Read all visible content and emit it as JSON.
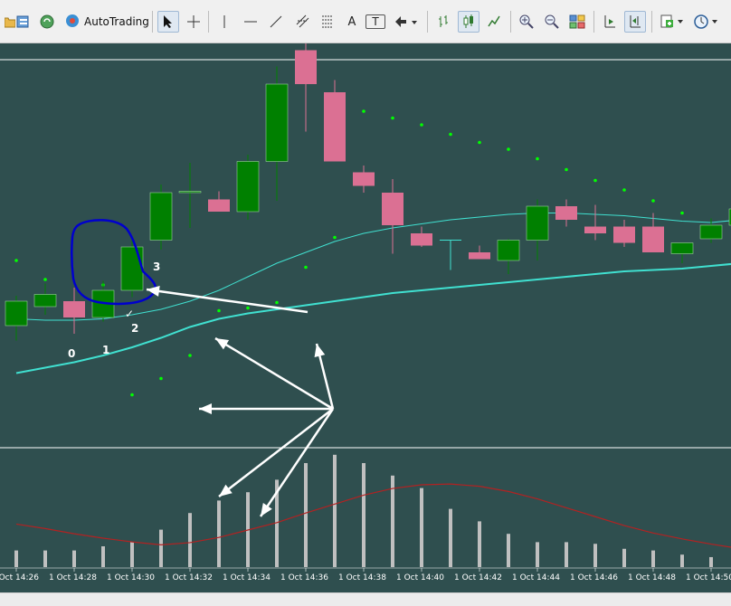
{
  "toolbar": {
    "autotrading_label": "AutoTrading",
    "font_button_label": "A",
    "text_label_button_label": "T",
    "icons": [
      "folder-icon",
      "market-watch-icon",
      "signals-icon",
      "autotrading-icon",
      "cursor-icon",
      "crosshair-icon",
      "vertical-line-icon",
      "horizontal-line-icon",
      "trendline-icon",
      "equidistant-channel-icon",
      "fibonacci-icon",
      "text-icon",
      "text-label-icon",
      "arrows-icon",
      "bar-chart-icon",
      "candlesticks-icon",
      "line-chart-icon",
      "zoom-in-icon",
      "zoom-out-icon",
      "tile-windows-icon",
      "chart-shift-icon",
      "auto-scroll-icon",
      "indicators-icon",
      "periods-icon"
    ]
  },
  "colors": {
    "background": "#2f4f4f",
    "bull_candle": "#008000",
    "bear_candle": "#db7093",
    "ma_line": "#40e0d0",
    "psar_dot": "#00ff00",
    "volume_bar": "#c0c0c0",
    "signal_line": "#b22222",
    "annotation_circle": "#0000cd",
    "annotation_arrow": "#ffffff"
  },
  "chart_data": {
    "type": "candlestick",
    "time_labels": [
      "1 Oct 14:26",
      "1 Oct 14:28",
      "1 Oct 14:30",
      "1 Oct 14:32",
      "1 Oct 14:34",
      "1 Oct 14:36",
      "1 Oct 14:38",
      "1 Oct 14:40",
      "1 Oct 14:42",
      "1 Oct 14:44",
      "1 Oct 14:46",
      "1 Oct 14:48",
      "1 Oct 14:50"
    ],
    "candles": [
      {
        "o": 0.4,
        "h": 2.6,
        "l": -0.7,
        "c": 2.2
      },
      {
        "o": 1.8,
        "h": 3.5,
        "l": 1.2,
        "c": 2.7
      },
      {
        "o": 2.2,
        "h": 3.2,
        "l": -0.2,
        "c": 1.0
      },
      {
        "o": 1.0,
        "h": 3.7,
        "l": 0.7,
        "c": 3.0
      },
      {
        "o": 3.0,
        "h": 6.7,
        "l": 2.5,
        "c": 6.2
      },
      {
        "o": 6.7,
        "h": 10.8,
        "l": 6.0,
        "c": 10.2
      },
      {
        "o": 10.2,
        "h": 12.4,
        "l": 7.6,
        "c": 10.3
      },
      {
        "o": 9.7,
        "h": 10.3,
        "l": 9.3,
        "c": 8.8
      },
      {
        "o": 8.8,
        "h": 13.0,
        "l": 8.2,
        "c": 12.5
      },
      {
        "o": 12.5,
        "h": 19.5,
        "l": 9.6,
        "c": 18.2
      },
      {
        "o": 20.7,
        "h": 21.2,
        "l": 14.7,
        "c": 18.2
      },
      {
        "o": 17.6,
        "h": 18.5,
        "l": 12.5,
        "c": 12.5
      },
      {
        "o": 11.7,
        "h": 12.2,
        "l": 10.2,
        "c": 10.7
      },
      {
        "o": 10.2,
        "h": 11.2,
        "l": 5.7,
        "c": 7.8
      },
      {
        "o": 7.2,
        "h": 7.7,
        "l": 6.2,
        "c": 6.3
      },
      {
        "o": 6.7,
        "h": 6.7,
        "l": 4.5,
        "c": 6.7
      },
      {
        "o": 5.8,
        "h": 6.3,
        "l": 5.3,
        "c": 5.3
      },
      {
        "o": 5.2,
        "h": 6.8,
        "l": 4.2,
        "c": 6.7
      },
      {
        "o": 6.7,
        "h": 9.7,
        "l": 5.2,
        "c": 9.2
      },
      {
        "o": 9.2,
        "h": 9.7,
        "l": 7.7,
        "c": 8.2
      },
      {
        "o": 7.7,
        "h": 9.3,
        "l": 6.7,
        "c": 7.2
      },
      {
        "o": 7.7,
        "h": 8.2,
        "l": 6.2,
        "c": 6.5
      },
      {
        "o": 7.7,
        "h": 8.7,
        "l": 6.2,
        "c": 5.8
      },
      {
        "o": 5.7,
        "h": 6.3,
        "l": 5.0,
        "c": 6.5
      },
      {
        "o": 6.8,
        "h": 8.3,
        "l": 6.5,
        "c": 7.8
      },
      {
        "o": 7.8,
        "h": 10.5,
        "l": 7.5,
        "c": 9.0
      }
    ],
    "moving_average_fast": [
      0.9,
      0.8,
      0.8,
      0.9,
      1.2,
      1.6,
      2.2,
      3.0,
      4.0,
      5.0,
      5.8,
      6.6,
      7.2,
      7.6,
      7.9,
      8.2,
      8.4,
      8.6,
      8.7,
      8.7,
      8.6,
      8.5,
      8.3,
      8.1,
      8.0,
      8.2
    ],
    "moving_average_slow": [
      -3.1,
      -2.7,
      -2.3,
      -1.8,
      -1.2,
      -0.5,
      0.3,
      0.9,
      1.3,
      1.6,
      1.9,
      2.2,
      2.5,
      2.8,
      3.0,
      3.2,
      3.4,
      3.6,
      3.8,
      4.0,
      4.2,
      4.4,
      4.5,
      4.6,
      4.8,
      5.0
    ],
    "parabolic_sar": [
      5.2,
      3.8,
      null,
      3.4,
      -4.7,
      -3.5,
      -1.8,
      1.5,
      1.7,
      2.1,
      4.7,
      6.9,
      16.2,
      15.7,
      15.2,
      14.5,
      13.9,
      13.4,
      12.7,
      11.9,
      11.1,
      10.4,
      9.6,
      8.7,
      null,
      null
    ],
    "volume": [
      2,
      2,
      2,
      2.5,
      3,
      4.5,
      6.5,
      8,
      9,
      10.5,
      12.5,
      13.5,
      12.5,
      11,
      9.5,
      7,
      5.5,
      4,
      3,
      3,
      2.8,
      2.2,
      2,
      1.5,
      1.2,
      1.2
    ],
    "signal_line": [
      5.8,
      5.2,
      4.5,
      3.9,
      3.4,
      3.0,
      3.3,
      4.0,
      5.0,
      6.0,
      7.3,
      8.5,
      9.7,
      10.6,
      11.1,
      11.2,
      10.9,
      10.2,
      9.2,
      8.0,
      6.8,
      5.6,
      4.6,
      3.8,
      3.1,
      2.5
    ],
    "annotations": {
      "candle_labels": [
        "0",
        "1",
        "2",
        "3"
      ],
      "checkmark": "✓"
    }
  }
}
